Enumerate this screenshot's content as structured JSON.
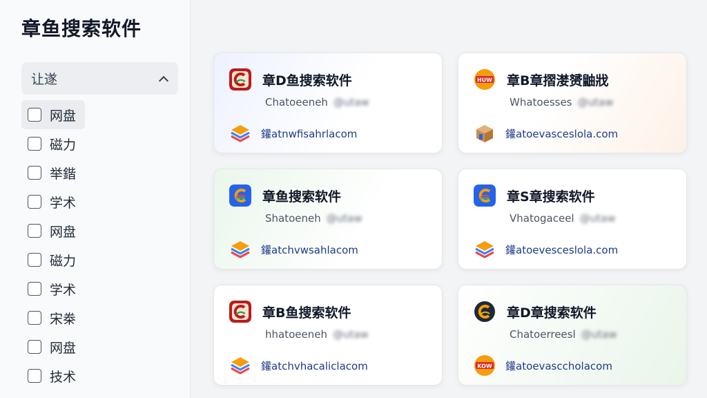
{
  "sidebar": {
    "title": "章鱼搜索软件",
    "filter_label": "让遂",
    "options": [
      {
        "label": "网盘"
      },
      {
        "label": "磁力"
      },
      {
        "label": "举鍇"
      },
      {
        "label": "学术"
      },
      {
        "label": "网盘"
      },
      {
        "label": "磁力"
      },
      {
        "label": "学术"
      },
      {
        "label": "宋桊"
      },
      {
        "label": "网盘"
      },
      {
        "label": "技术"
      }
    ]
  },
  "cards": [
    {
      "title": "章D鱼搜索软件",
      "subtitle": "Chatoeeneh",
      "subtitle_blur": "@utaw",
      "url": "鑵atnwfisahrlacom",
      "app_icon": "red-c-app-icon",
      "link_icon": "layers-stack-icon"
    },
    {
      "title": "章B章摺漤赟鼬戕",
      "subtitle": "Whatoesses",
      "subtitle_blur": "@utaw",
      "url": "鑵atoevasceslola.com",
      "app_icon": "huw-badge-icon",
      "link_icon": "package-box-icon"
    },
    {
      "title": "章鱼搜索软件",
      "subtitle": "Shatoeneh",
      "subtitle_blur": "@utaw",
      "url": "鑵atchvwsahlacom",
      "app_icon": "blue-c-app-icon",
      "link_icon": "layers-stack-icon"
    },
    {
      "title": "章S章搜索软件",
      "subtitle": "Vhatogaceel",
      "subtitle_blur": "@utaw",
      "url": "鑵atoevesceslola.com",
      "app_icon": "blue-c-app-icon",
      "link_icon": "layers-stack-icon"
    },
    {
      "title": "章B鱼搜索软件",
      "subtitle": "hhatoeeneh",
      "subtitle_blur": "@utaw",
      "url": "鑵atchvhacaliclacom",
      "app_icon": "red-c-app-icon",
      "link_icon": "layers-stack-icon"
    },
    {
      "title": "章D章搜索软件",
      "subtitle": "Chatoerreesl",
      "subtitle_blur": "@utaw",
      "url": "鑵atoevasccholacom",
      "app_icon": "dark-c-app-icon",
      "link_icon": "kow-badge-icon"
    }
  ]
}
